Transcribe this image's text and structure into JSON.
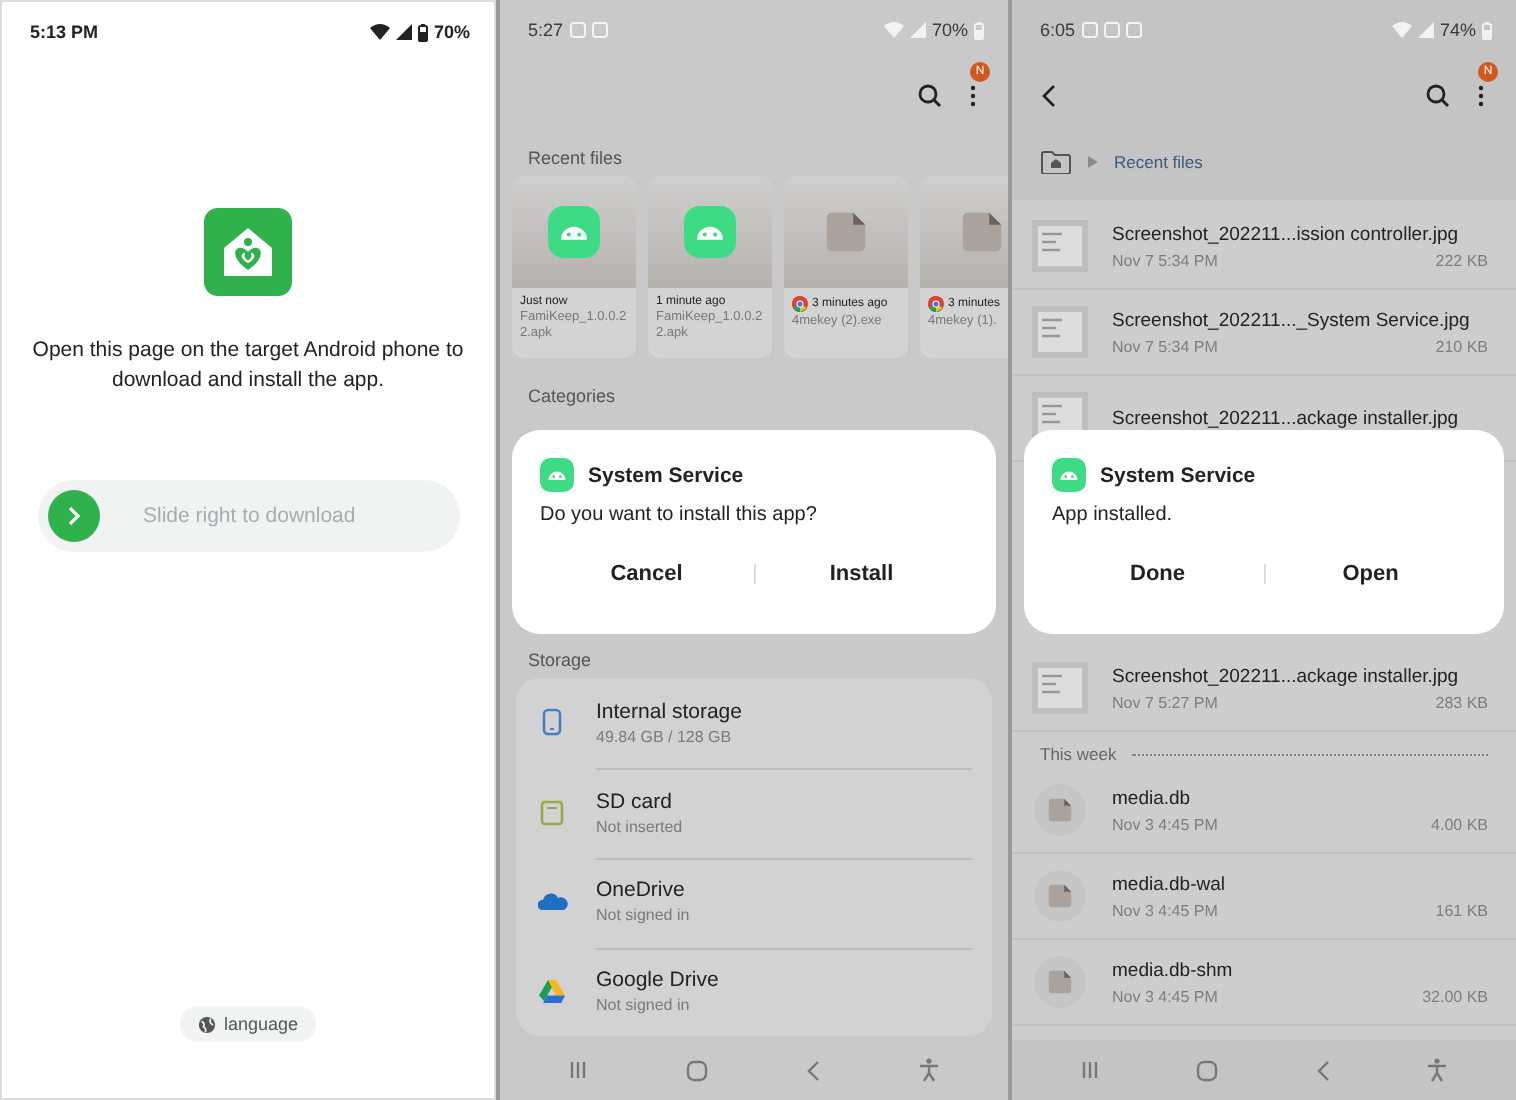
{
  "download_page": {
    "status_bar": {
      "time": "5:13 PM",
      "battery": "70%"
    },
    "message": "Open this page on the target Android phone to download and install the app.",
    "slider": {
      "label": "Slide right to download"
    },
    "language_button": "language"
  },
  "install_screen": {
    "status_bar": {
      "time": "5:27",
      "battery": "70%"
    },
    "menu_badge": "N",
    "recent_title": "Recent files",
    "recent_files": [
      {
        "kind": "apk",
        "time": "Just now",
        "name": "FamiKeep_1.0.0.22.apk"
      },
      {
        "kind": "apk",
        "time": "1 minute ago",
        "name": "FamiKeep_1.0.0.22.apk"
      },
      {
        "kind": "download",
        "time": "3 minutes ago",
        "name": "4mekey (2).exe"
      },
      {
        "kind": "download",
        "time": "3 minutes",
        "name": "4mekey (1)."
      }
    ],
    "categories_title": "Categories",
    "dialog": {
      "app_name": "System Service",
      "message": "Do you want to install this app?",
      "buttons": [
        "Cancel",
        "Install"
      ]
    },
    "storage_title": "Storage",
    "storage": [
      {
        "kind": "phone",
        "name": "Internal storage",
        "detail": "49.84 GB / 128 GB"
      },
      {
        "kind": "sdcard",
        "name": "SD card",
        "detail": "Not inserted"
      },
      {
        "kind": "cloud",
        "name": "OneDrive",
        "detail": "Not signed in"
      },
      {
        "kind": "drive",
        "name": "Google Drive",
        "detail": "Not signed in"
      }
    ]
  },
  "installed_screen": {
    "status_bar": {
      "time": "6:05",
      "battery": "74%"
    },
    "menu_badge": "N",
    "breadcrumb": "Recent files",
    "files": [
      {
        "kind": "screenshot",
        "name": "Screenshot_202211...ission controller.jpg",
        "date": "Nov 7 5:34 PM",
        "size": "222 KB"
      },
      {
        "kind": "screenshot",
        "name": "Screenshot_202211..._System Service.jpg",
        "date": "Nov 7 5:34 PM",
        "size": "210 KB"
      },
      {
        "kind": "screenshot",
        "name": "Screenshot_202211...ackage installer.jpg"
      }
    ],
    "dialog": {
      "app_name": "System Service",
      "message": "App installed.",
      "buttons": [
        "Done",
        "Open"
      ]
    },
    "files_after_dialog": [
      {
        "kind": "screenshot",
        "name": "Screenshot_202211...ackage installer.jpg",
        "date": "Nov 7 5:27 PM",
        "size": "283 KB"
      }
    ],
    "this_week": {
      "title": "This week",
      "files": [
        {
          "kind": "file",
          "name": "media.db",
          "date": "Nov 3 4:45 PM",
          "size": "4.00 KB"
        },
        {
          "kind": "file",
          "name": "media.db-wal",
          "date": "Nov 3 4:45 PM",
          "size": "161 KB"
        },
        {
          "kind": "file",
          "name": "media.db-shm",
          "date": "Nov 3 4:45 PM",
          "size": "32.00 KB"
        }
      ]
    }
  }
}
